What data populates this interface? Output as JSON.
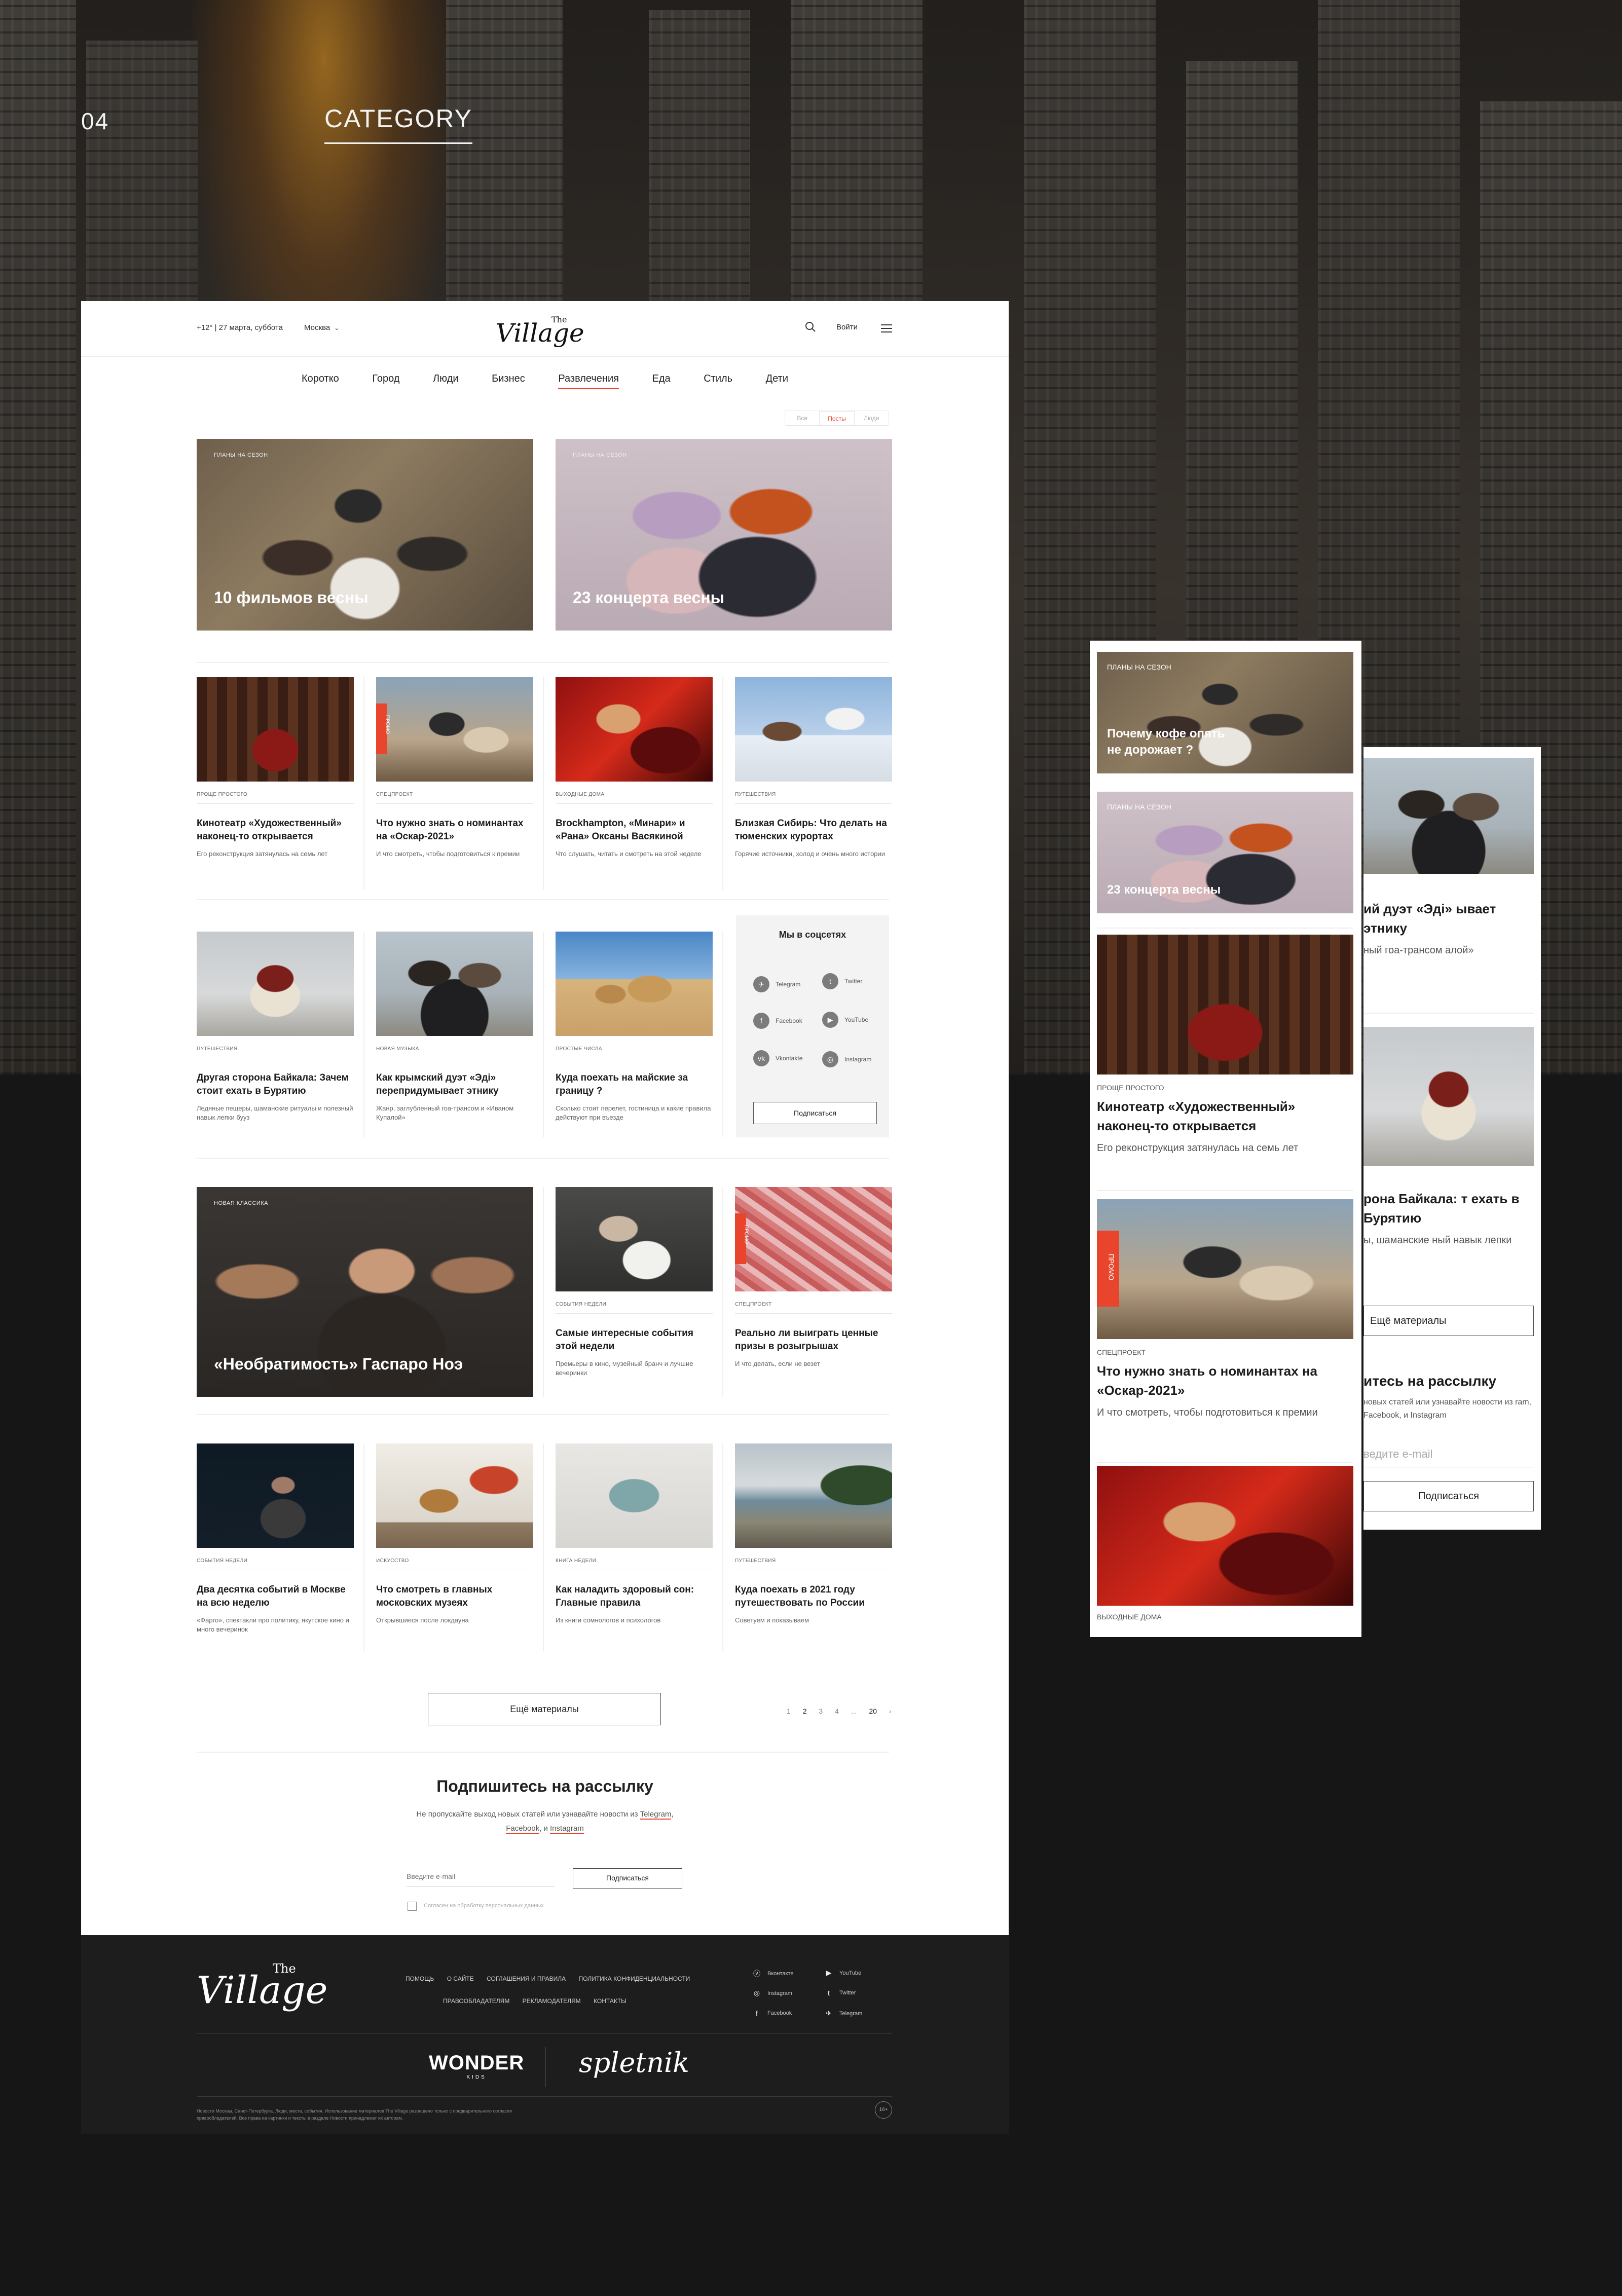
{
  "section": {
    "number": "04",
    "title": "CATEGORY"
  },
  "header": {
    "weather": "+12° | 27 марта, суббота",
    "city": "Москва",
    "logo_the": "The",
    "logo": "Village",
    "login": "Войти"
  },
  "nav": {
    "items": [
      "Коротко",
      "Город",
      "Люди",
      "Бизнес",
      "Развлечения",
      "Еда",
      "Стиль",
      "Дети"
    ],
    "active": "Развлечения"
  },
  "filter": {
    "options": [
      "Все",
      "Посты",
      "Люди"
    ],
    "active": "Посты"
  },
  "heroes": [
    {
      "rubric": "ПЛАНЫ НА СЕЗОН",
      "title": "10 фильмов весны"
    },
    {
      "rubric": "ПЛАНЫ НА СЕЗОН",
      "title": "23 концерта весны"
    }
  ],
  "row1": [
    {
      "rubric": "Проще простого",
      "title": "Кинотеатр «Художественный» наконец-то открывается",
      "sub": "Его реконструкция затянулась на семь лет"
    },
    {
      "rubric": "Спецпроект",
      "title": "Что нужно знать о номинантах на «Оскар-2021»",
      "sub": "И что смотреть, чтобы подготовиться к премии",
      "promo": "ПРОМО"
    },
    {
      "rubric": "Выходные дома",
      "title": "Brockhampton, «Минари» и «Рана» Оксаны Васякиной",
      "sub": "Что слушать, читать и смотреть на этой неделе"
    },
    {
      "rubric": "Путешествия",
      "title": "Близкая Сибирь: Что делать на тюменских курортах",
      "sub": "Горячие источники, холод и очень много истории"
    }
  ],
  "row2": [
    {
      "rubric": "Путешествия",
      "title": "Другая сторона Байкала: Зачем стоит ехать в Бурятию",
      "sub": "Ледяные пещеры, шаманские ритуалы и полезный навык лепки бууз"
    },
    {
      "rubric": "Новая музыка",
      "title": "Как крымский дуэт «Эді» перепридумывает этнику",
      "sub": "Жанр, заглубленный гоа-трансом и «Иваном Купалой»"
    },
    {
      "rubric": "Простые числа",
      "title": "Куда поехать на майские за границу ?",
      "sub": "Сколько стоит перелет, гостиница и какие правила действуют при въезде"
    }
  ],
  "social": {
    "title": "Мы в соцсетях",
    "networks": [
      "Telegram",
      "Twitter",
      "Facebook",
      "YouTube",
      "Vkontakte",
      "Instagram"
    ],
    "button": "Подписаться"
  },
  "row3_hero": {
    "rubric": "НОВАЯ КЛАССИКА",
    "title": "«Необратимость» Гаспаро Ноэ"
  },
  "row3": [
    {
      "rubric": "События недели",
      "title": "Самые интересные события этой недели",
      "sub": "Премьеры в кино, музейный бранч и лучшие вечеринки"
    },
    {
      "rubric": "Спецпроект",
      "title": "Реально ли выиграть ценные призы в розыгрышах",
      "sub": "И что делать, если не везет",
      "promo": "ПРОМО"
    }
  ],
  "row4": [
    {
      "rubric": "События недели",
      "title": "Два десятка событий в Москве на всю неделю",
      "sub": "«Фарго», спектакли про политику, якутское кино и много вечеринок"
    },
    {
      "rubric": "Искусство",
      "title": "Что смотреть в главных московских музеях",
      "sub": "Открывшиеся после локдауна"
    },
    {
      "rubric": "Книга недели",
      "title": "Как наладить здоровый сон: Главные правила",
      "sub": "Из книги сомнологов и психологов"
    },
    {
      "rubric": "Путешествия",
      "title": "Куда поехать в 2021 году путешествовать по России",
      "sub": "Советуем и показываем"
    }
  ],
  "more": {
    "button": "Ещё материалы",
    "pages": [
      "1",
      "2",
      "3",
      "4",
      "...",
      "20"
    ],
    "current": "2"
  },
  "subscribe": {
    "title": "Подпишитесь на рассылку",
    "text_before": "Не пропускайте выход новых статей или узнавайте новости из",
    "link1": "Telegram",
    "sep1": ",",
    "link2": "Facebook",
    "sep2": ", и",
    "link3": "Instagram",
    "placeholder": "Введите e-mail",
    "button": "Подписаться",
    "consent": "Согласен на обработку персональных данных"
  },
  "footer": {
    "logo_the": "The",
    "logo": "Village",
    "links": [
      "Помощь",
      "О сайте",
      "Соглашения и правила",
      "Политика конфиденциальности",
      "Правообладателям",
      "Рекламодателям",
      "Контакты"
    ],
    "social": [
      "Вконтакте",
      "YouTube",
      "Instagram",
      "Twitter",
      "Facebook",
      "Telegram"
    ],
    "partner1": "WONDER",
    "partner1_sub": "KIDS",
    "partner2": "spletnik",
    "legal": "Новости Москвы, Санкт-Петербурга. Люди, места, события. Использование материалов The Village разрешено только с предварительного согласия правообладателей. Все права на картинки и тексты в разделе Новости принадлежат их авторам.",
    "age": "16+"
  },
  "mobile1": {
    "hero1": {
      "rubric": "ПЛАНЫ НА СЕЗОН",
      "title": "Почему кофе опять не дорожает ?"
    },
    "hero2": {
      "rubric": "ПЛАНЫ НА СЕЗОН",
      "title": "23 концерта весны"
    },
    "card1": {
      "rubric": "Проще простого",
      "title": "Кинотеатр «Художественный» наконец-то открывается",
      "sub": "Его реконструкция затянулась на семь лет"
    },
    "card2": {
      "rubric": "Спецпроект",
      "title": "Что нужно знать о номинантах на «Оскар-2021»",
      "sub": "И что смотреть, чтобы подготовиться к премии",
      "promo": "ПРОМО"
    },
    "card3": {
      "rubric": "Выходные дома"
    }
  },
  "mobile2": {
    "card1": {
      "title": "ий дуэт «Эді» ывает этнику",
      "sub": "ный гоа-трансом алой»"
    },
    "card2": {
      "title": "рона Байкала: т ехать в Бурятию",
      "sub": "ы, шаманские ный навык лепки"
    },
    "more": "Ещё материалы",
    "sub_title": "итесь на рассылку",
    "sub_text": "новых статей или узнавайте новости из ram, Facebook, и Instagram",
    "placeholder": "ведите e-mail",
    "button": "Подписаться"
  }
}
